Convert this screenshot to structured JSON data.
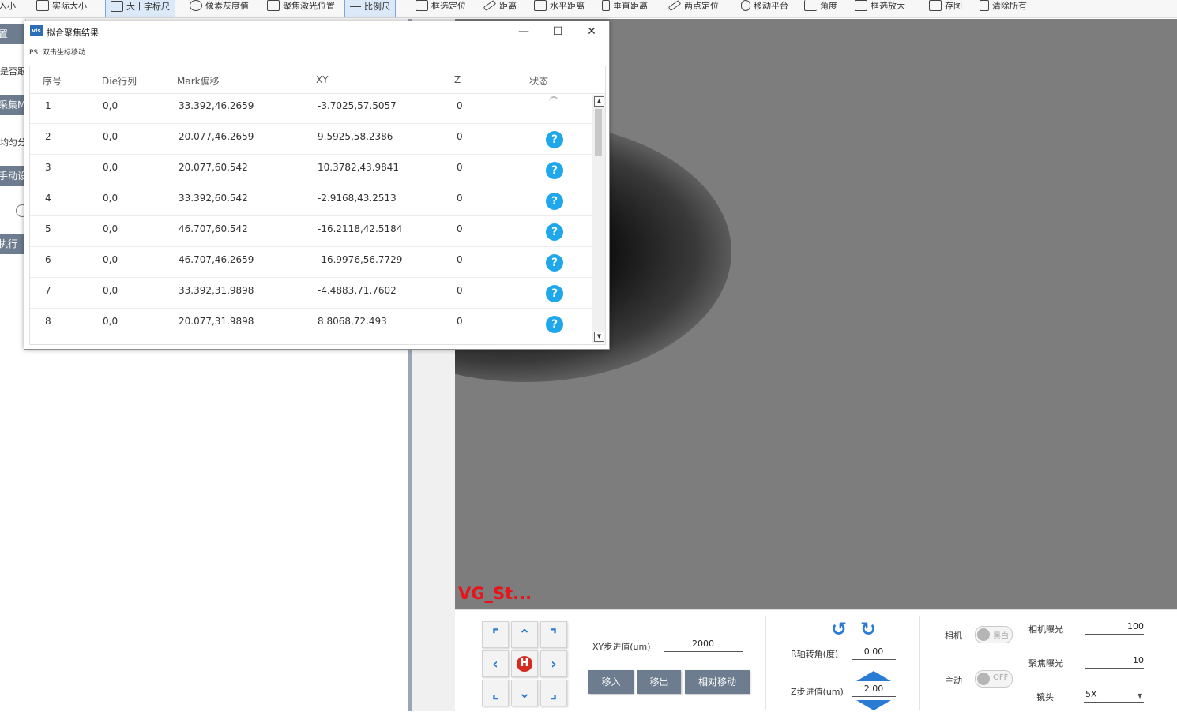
{
  "toolbar": {
    "items": [
      {
        "label": "入小",
        "active": false
      },
      {
        "label": "实际大小",
        "active": false
      },
      {
        "label": "大十字标尺",
        "active": true
      },
      {
        "label": "像素灰度值",
        "active": false
      },
      {
        "label": "聚焦激光位置",
        "active": false
      },
      {
        "label": "比例尺",
        "active": true
      },
      {
        "label": "框选定位",
        "active": false
      },
      {
        "label": "距离",
        "active": false
      },
      {
        "label": "水平距离",
        "active": false
      },
      {
        "label": "垂直距离",
        "active": false
      },
      {
        "label": "两点定位",
        "active": false
      },
      {
        "label": "移动平台",
        "active": false
      },
      {
        "label": "角度",
        "active": false
      },
      {
        "label": "框选放大",
        "active": false
      },
      {
        "label": "存图",
        "active": false
      },
      {
        "label": "清除所有",
        "active": false
      }
    ]
  },
  "left_panel": {
    "btn1": "置",
    "label1": "是否跟",
    "btn2": "采集M",
    "label2": "均匀分",
    "btn3": "手动设",
    "btn4": "执行"
  },
  "dialog": {
    "title": "拟合聚焦结果",
    "icon_text": "vis",
    "minimize": "—",
    "maximize": "☐",
    "close": "✕",
    "hint": "PS: 双击坐标移动",
    "columns": [
      "序号",
      "Die行列",
      "Mark偏移",
      "XY",
      "Z",
      "状态"
    ],
    "rows": [
      {
        "idx": "1",
        "die": "0,0",
        "mark": "33.392,46.2659",
        "xy": "-3.7025,57.5057",
        "z": "0",
        "status": "loading"
      },
      {
        "idx": "2",
        "die": "0,0",
        "mark": "20.077,46.2659",
        "xy": "9.5925,58.2386",
        "z": "0",
        "status": "?"
      },
      {
        "idx": "3",
        "die": "0,0",
        "mark": "20.077,60.542",
        "xy": "10.3782,43.9841",
        "z": "0",
        "status": "?"
      },
      {
        "idx": "4",
        "die": "0,0",
        "mark": "33.392,60.542",
        "xy": "-2.9168,43.2513",
        "z": "0",
        "status": "?"
      },
      {
        "idx": "5",
        "die": "0,0",
        "mark": "46.707,60.542",
        "xy": "-16.2118,42.5184",
        "z": "0",
        "status": "?"
      },
      {
        "idx": "6",
        "die": "0,0",
        "mark": "46.707,46.2659",
        "xy": "-16.9976,56.7729",
        "z": "0",
        "status": "?"
      },
      {
        "idx": "7",
        "die": "0,0",
        "mark": "33.392,31.9898",
        "xy": "-4.4883,71.7602",
        "z": "0",
        "status": "?"
      },
      {
        "idx": "8",
        "die": "0,0",
        "mark": "20.077,31.9898",
        "xy": "8.8068,72.493",
        "z": "0",
        "status": "?"
      }
    ]
  },
  "view": {
    "label": "VG_St..."
  },
  "controls": {
    "dpad": {
      "up_left": "⌜",
      "up": "⌃",
      "up_right": "⌝",
      "left": "‹",
      "home": "H",
      "right": "›",
      "down_left": "⌞",
      "down": "⌄",
      "down_right": "⌟"
    },
    "xy_step_label": "XY步进值(um)",
    "xy_step_value": "2000",
    "move_in": "移入",
    "move_out": "移出",
    "relative_move": "相对移动",
    "r_angle_label": "R轴转角(度)",
    "r_angle_value": "0.00",
    "z_step_label": "Z步进值(um)",
    "z_step_value": "2.00",
    "camera_label": "相机",
    "camera_toggle": "黑白",
    "active_label": "主动",
    "active_toggle": "OFF",
    "camera_exposure_label": "相机曝光",
    "camera_exposure_value": "100",
    "focus_exposure_label": "聚焦曝光",
    "focus_exposure_value": "10",
    "lens_label": "镜头",
    "lens_value": "5X"
  }
}
